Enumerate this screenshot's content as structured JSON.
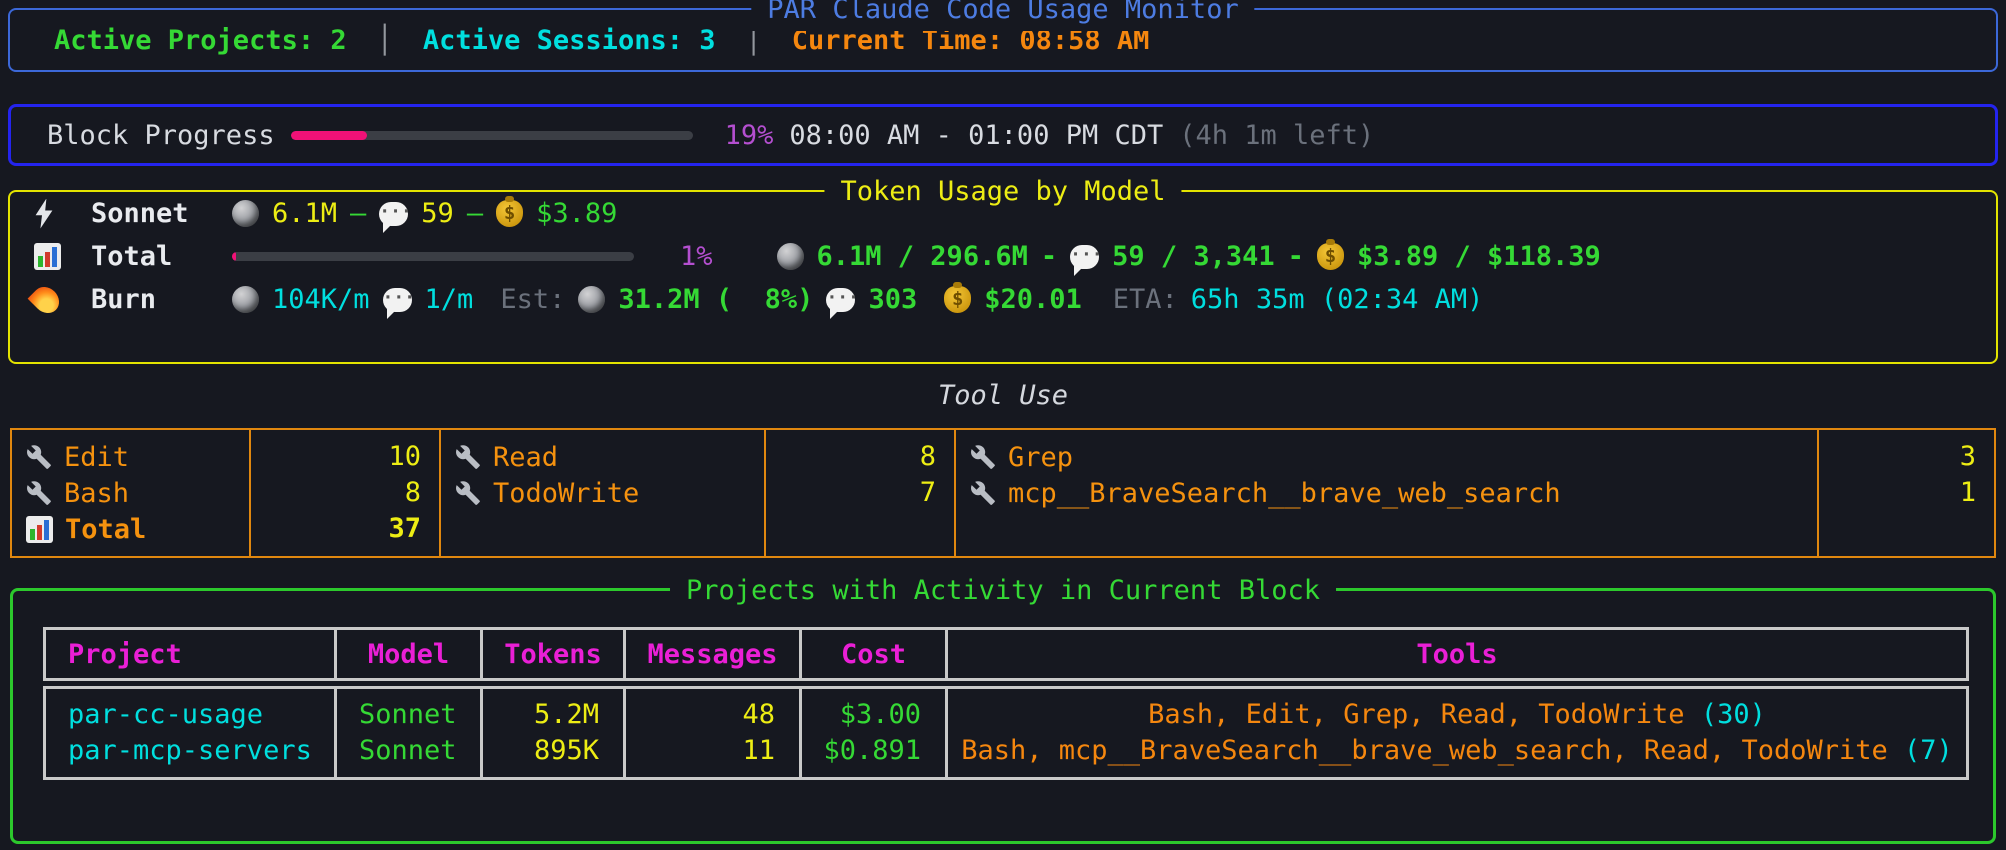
{
  "colors": {
    "background": "#161820",
    "header_border": "#3c68d8",
    "progress_border": "#2424ee",
    "token_border": "#e3e300",
    "tool_border": "#e0870f",
    "projects_border": "#2cc82c",
    "table_border": "#c9c9c9",
    "progress_fill": "#f01177",
    "green": "#35d935",
    "cyan": "#00dfdf",
    "orange": "#f5870f",
    "yellow": "#eded14",
    "magenta": "#ea1fd6",
    "violet": "#b44fd0"
  },
  "icons": {
    "model": "lightning-icon",
    "total": "bar-chart-icon",
    "burn": "fire-icon",
    "tokens": "moon-icon",
    "messages": "speech-balloon-icon",
    "cost": "money-bag-icon",
    "tool": "wrench-icon"
  },
  "header": {
    "title": "PAR Claude Code Usage Monitor",
    "active_projects": "Active Projects: 2",
    "active_sessions": "Active Sessions: 3",
    "current_time": "Current Time: 08:58 AM",
    "divider": "│"
  },
  "block_progress": {
    "label": "Block Progress",
    "percent_label": "19%",
    "percent_value": 19,
    "time_range": "08:00 AM - 01:00 PM CDT",
    "time_left": "(4h 1m left)"
  },
  "token_usage": {
    "title": "Token Usage by Model",
    "sonnet": {
      "label": "Sonnet",
      "tokens": "6.1M",
      "dash1": "–",
      "messages": "59",
      "dash2": "–",
      "cost": "$3.89"
    },
    "total": {
      "label": "Total",
      "percent_label": "1%",
      "percent_value": 1,
      "tokens": "6.1M / 296.6M",
      "dash1": "-",
      "messages": "59 / 3,341",
      "dash2": "-",
      "cost": "$3.89 / $118.39"
    },
    "burn": {
      "label": "Burn",
      "token_rate": "104K/m",
      "message_rate": "1/m",
      "est_label": "Est:",
      "est_tokens": "31.2M (  8%)",
      "est_messages": "303",
      "est_cost": "$20.01",
      "eta_label": "ETA:",
      "eta_value": "65h 35m (02:34 AM)"
    }
  },
  "tool_use": {
    "title": "Tool Use",
    "groups": [
      {
        "rows": [
          {
            "name": "Edit",
            "count": "10"
          },
          {
            "name": "Bash",
            "count": "8"
          }
        ],
        "total_row": {
          "name": "Total",
          "count": "37"
        }
      },
      {
        "rows": [
          {
            "name": "Read",
            "count": "8"
          },
          {
            "name": "TodoWrite",
            "count": "7"
          }
        ]
      },
      {
        "rows": [
          {
            "name": "Grep",
            "count": "3"
          },
          {
            "name": "mcp__BraveSearch__brave_web_search",
            "count": "1"
          }
        ]
      }
    ]
  },
  "projects": {
    "title": "Projects with Activity in Current Block",
    "headers": [
      "Project",
      "Model",
      "Tokens",
      "Messages",
      "Cost",
      "Tools"
    ],
    "rows": [
      {
        "project": "par-cc-usage",
        "model": "Sonnet",
        "tokens": "5.2M",
        "messages": "48",
        "cost": "$3.00",
        "tools": "Bash, Edit, Grep, Read, TodoWrite",
        "tool_count": "(30)"
      },
      {
        "project": "par-mcp-servers",
        "model": "Sonnet",
        "tokens": "895K",
        "messages": "11",
        "cost": "$0.891",
        "tools": "Bash, mcp__BraveSearch__brave_web_search, Read, TodoWrite",
        "tool_count": "(7)"
      }
    ]
  }
}
